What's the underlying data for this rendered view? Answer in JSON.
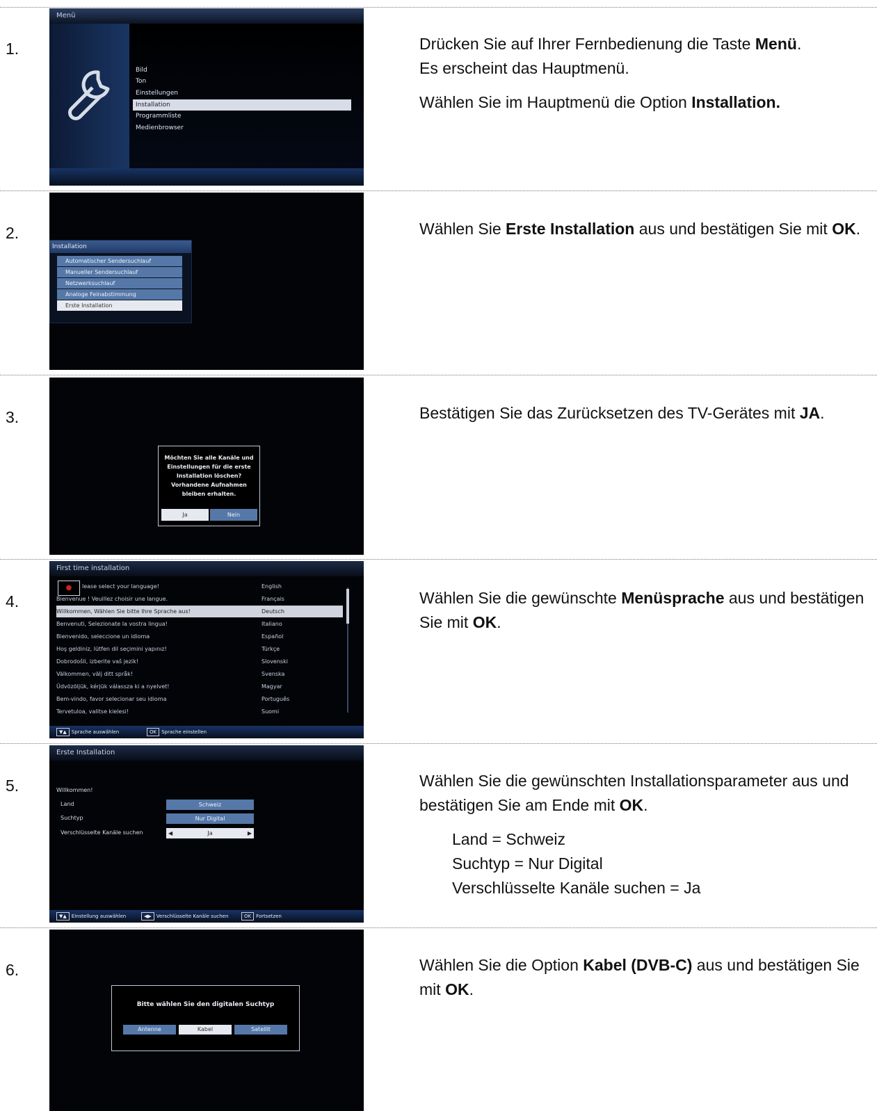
{
  "steps": [
    {
      "num": "1.",
      "lines": [
        [
          "Drücken Sie auf Ihrer Fernbedienung die Taste ",
          "Menü",
          "."
        ],
        [
          "Es erscheint das Hauptmenü."
        ],
        [
          "Wählen Sie im Hauptmenü die Option ",
          "Installation.",
          ""
        ]
      ]
    },
    {
      "num": "2."
    },
    {
      "num": "3."
    },
    {
      "num": "4."
    },
    {
      "num": "5."
    },
    {
      "num": "6."
    }
  ],
  "text": {
    "s1a": "Drücken Sie auf Ihrer Fernbedienung die Taste ",
    "s1a_b": "Menü",
    "s1a_e": ".",
    "s1b": "Es erscheint das Hauptmenü.",
    "s1c": "Wählen Sie im Hauptmenü die Option ",
    "s1c_b": "Installation.",
    "s2a": "Wählen Sie ",
    "s2a_b": "Erste Installation",
    "s2a_c": " aus und bestätigen Sie mit ",
    "s2a_d": "OK",
    "s2a_e": ".",
    "s3a": "Bestätigen Sie das Zurücksetzen des TV-Gerätes mit ",
    "s3a_b": "JA",
    "s3a_e": ".",
    "s4a": "Wählen Sie die gewünschte ",
    "s4a_b": "Menüsprache",
    "s4a_c": " aus und bestätigen Sie mit ",
    "s4a_d": "OK",
    "s4a_e": ".",
    "s5a": "Wählen Sie die gewünschten Installationsparameter aus und bestätigen Sie am Ende mit ",
    "s5a_b": "OK",
    "s5a_e": ".",
    "s5p1": "Land = Schweiz",
    "s5p2": "Suchtyp = Nur Digital",
    "s5p3": "Verschlüsselte Kanäle suchen = Ja",
    "s6a": "Wählen Sie die Option ",
    "s6a_b": "Kabel (DVB-C)",
    "s6a_c": " aus und bestätigen Sie mit ",
    "s6a_d": "OK",
    "s6a_e": "."
  },
  "shot1": {
    "title": "Menü",
    "items": [
      "Bild",
      "Ton",
      "Einstellungen",
      "Installation",
      "Programmliste",
      "Medienbrowser"
    ]
  },
  "shot2": {
    "title": "Installation",
    "items": [
      "Automatischer Sendersuchlauf",
      "Manueller Sendersuchlauf",
      "Netzwerksuchlauf",
      "Analoge Feinabstimmung",
      "Erste Installation"
    ]
  },
  "shot3": {
    "message": "Möchten Sie alle Kanäle und Einstellungen für die erste Installation löschen? Vorhandene Aufnahmen bleiben erhalten.",
    "yes": "Ja",
    "no": "Nein"
  },
  "shot4": {
    "title": "First time installation",
    "rows": [
      {
        "g": "lease select your language!",
        "l": "English"
      },
      {
        "g": "Bienvenue ! Veuillez choisir une langue.",
        "l": "Français"
      },
      {
        "g": "Willkommen, Wählen Sie bitte Ihre Sprache aus!",
        "l": "Deutsch"
      },
      {
        "g": "Benvenuti, Selezionate la vostra lingua!",
        "l": "Italiano"
      },
      {
        "g": "Bienvenido, seleccione un idioma",
        "l": "Español"
      },
      {
        "g": "Hoş geldiniz, lütfen dil seçimini yapınız!",
        "l": "Türkçe"
      },
      {
        "g": "Dobrodošli, izberite vaš jezik!",
        "l": "Slovenski"
      },
      {
        "g": "Välkommen, välj ditt språk!",
        "l": "Svenska"
      },
      {
        "g": "Üdvözöljük, kérjük válassza ki a nyelvet!",
        "l": "Magyar"
      },
      {
        "g": "Bem-vindo, favor selecionar seu idioma",
        "l": "Português"
      },
      {
        "g": "Tervetuloa, valitse kielesi!",
        "l": "Suomi"
      }
    ],
    "foot1": "Sprache auswählen",
    "foot2": "Sprache einstellen",
    "key1": "▼▲",
    "key2": "OK"
  },
  "shot5": {
    "title": "Erste Installation",
    "welcome": "Willkommen!",
    "land_lbl": "Land",
    "land_val": "Schweiz",
    "such_lbl": "Suchtyp",
    "such_val": "Nur Digital",
    "enc_lbl": "Verschlüsselte Kanäle suchen",
    "enc_val": "Ja",
    "foot1": "Einstellung auswählen",
    "foot2": "Verschlüsselte Kanäle suchen",
    "foot3": "Fortsetzen",
    "key1": "▼▲",
    "key2": "◀▶",
    "key3": "OK"
  },
  "shot6": {
    "message": "Bitte wählen Sie den digitalen Suchtyp",
    "b1": "Antenne",
    "b2": "Kabel",
    "b3": "Satellit"
  }
}
